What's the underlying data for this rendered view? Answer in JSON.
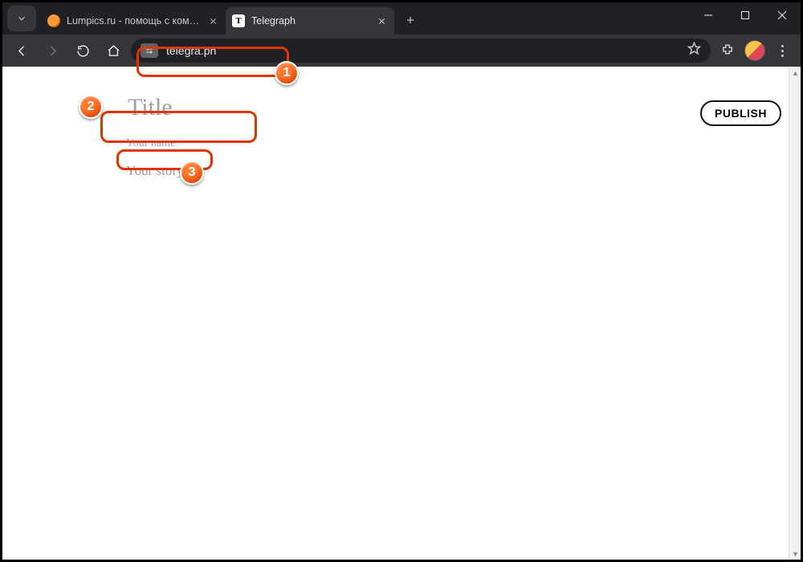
{
  "window": {
    "tabs": [
      {
        "title": "Lumpics.ru - помощь с компью",
        "active": false
      },
      {
        "title": "Telegraph",
        "active": true,
        "favicon_letter": "T"
      }
    ],
    "win_controls": {
      "minimize": "minimize",
      "maximize": "maximize",
      "close": "close"
    }
  },
  "toolbar": {
    "back": "back",
    "forward": "forward",
    "reload": "reload",
    "home": "home",
    "url": "telegra.ph",
    "bookmark": "star",
    "extensions": "extensions",
    "menu": "menu"
  },
  "editor": {
    "title_placeholder": "Title",
    "name_placeholder": "Your name",
    "story_placeholder": "Your story...",
    "publish_label": "PUBLISH"
  },
  "annotations": {
    "b1": "1",
    "b2": "2",
    "b3": "3"
  }
}
